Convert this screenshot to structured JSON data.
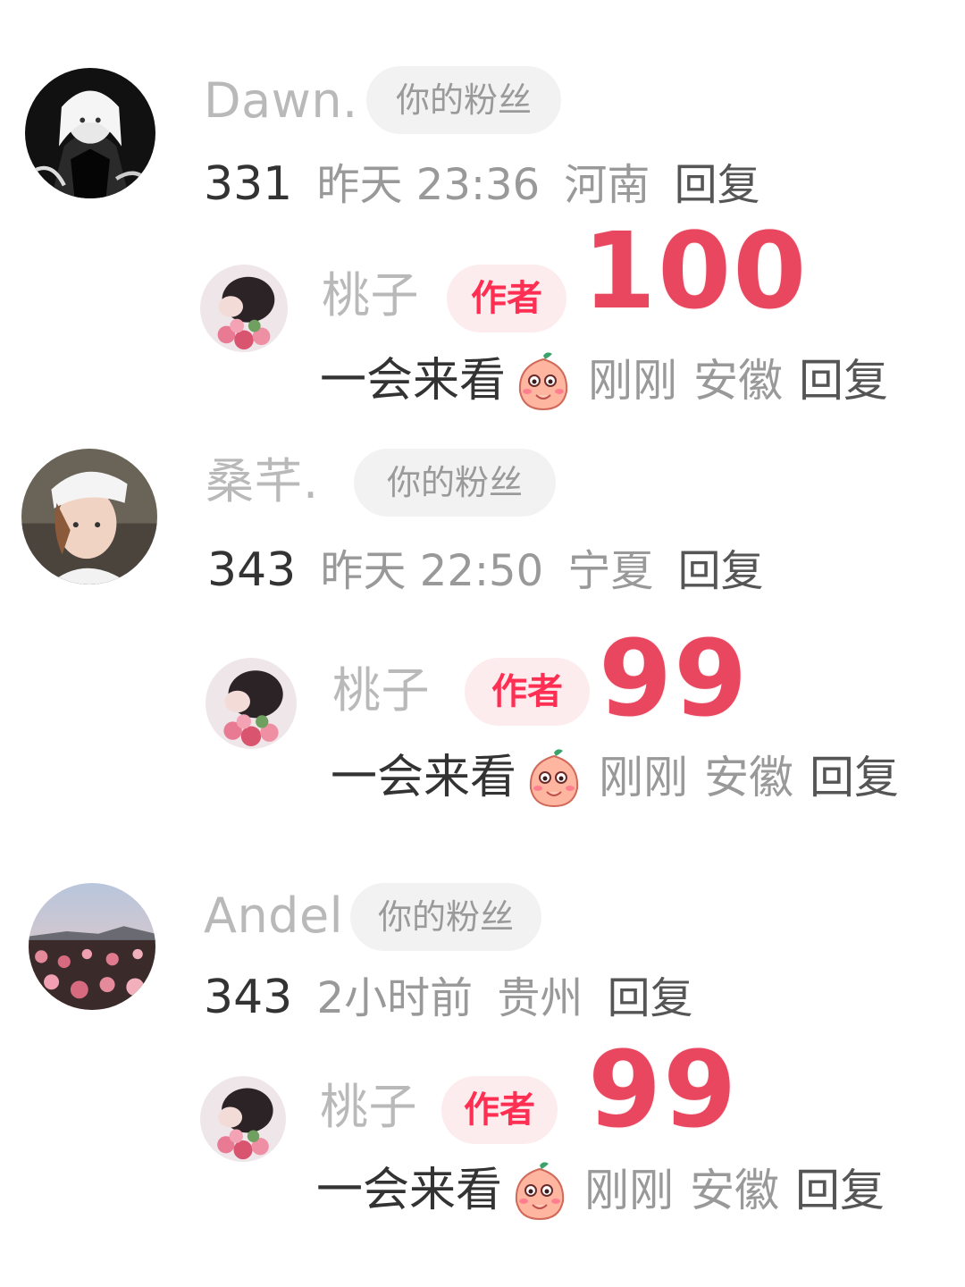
{
  "comments": [
    {
      "user": {
        "name": "Dawn.",
        "badge": "你的粉丝",
        "avatar": "anime-girl-avatar"
      },
      "likes": "331",
      "time": "昨天 23:36",
      "location": "河南",
      "reply_label": "回复",
      "author_reply": {
        "name": "桃子",
        "badge": "作者",
        "content": "一会来看",
        "emoji": "peach-face-emoji",
        "time": "刚刚",
        "location": "安徽",
        "reply_label": "回复",
        "overlay_number": "100"
      }
    },
    {
      "user": {
        "name": "桑芊.",
        "badge": "你的粉丝",
        "avatar": "girl-cap-avatar"
      },
      "likes": "343",
      "time": "昨天 22:50",
      "location": "宁夏",
      "reply_label": "回复",
      "author_reply": {
        "name": "桃子",
        "badge": "作者",
        "content": "一会来看",
        "emoji": "peach-face-emoji",
        "time": "刚刚",
        "location": "安徽",
        "reply_label": "回复",
        "overlay_number": "99"
      }
    },
    {
      "user": {
        "name": "Andel",
        "badge": "你的粉丝",
        "avatar": "rose-field-avatar"
      },
      "likes": "343",
      "time": "2小时前",
      "location": "贵州",
      "reply_label": "回复",
      "author_reply": {
        "name": "桃子",
        "badge": "作者",
        "content": "一会来看",
        "emoji": "peach-face-emoji",
        "time": "刚刚",
        "location": "安徽",
        "reply_label": "回复",
        "overlay_number": "99"
      }
    }
  ],
  "colors": {
    "author_badge_text": "#ff2f53",
    "author_badge_bg": "#fdecee",
    "fan_badge_bg": "#f2f2f2",
    "overlay_number": "#e8475f"
  }
}
